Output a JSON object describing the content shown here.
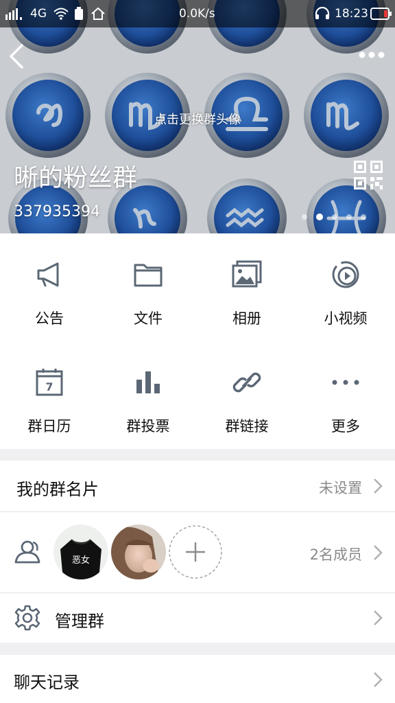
{
  "status_bar": {
    "network": "4G",
    "speed": "0.0K/s",
    "time": "18:23"
  },
  "header": {
    "change_avatar_hint": "点击更换群头像",
    "group_name": "晰的粉丝群",
    "group_id": "337935394",
    "page_dots": 5,
    "active_dot": 0
  },
  "actions": [
    {
      "label": "公告",
      "icon": "megaphone-icon"
    },
    {
      "label": "文件",
      "icon": "folder-icon"
    },
    {
      "label": "相册",
      "icon": "album-icon"
    },
    {
      "label": "小视频",
      "icon": "video-icon"
    },
    {
      "label": "群日历",
      "icon": "calendar-icon"
    },
    {
      "label": "群投票",
      "icon": "vote-icon"
    },
    {
      "label": "群链接",
      "icon": "link-icon"
    },
    {
      "label": "更多",
      "icon": "more-icon"
    }
  ],
  "calendar_day": "7",
  "card_row": {
    "title": "我的群名片",
    "value": "未设置"
  },
  "members_row": {
    "count_text": "2名成员",
    "member_shirt_text": "恶女"
  },
  "manage_row": {
    "title": "管理群"
  },
  "chat_row": {
    "title": "聊天记录"
  },
  "colors": {
    "icon": "#5b6775",
    "bg": "#f0f0f2",
    "header_bg": "#c9ccd1"
  }
}
